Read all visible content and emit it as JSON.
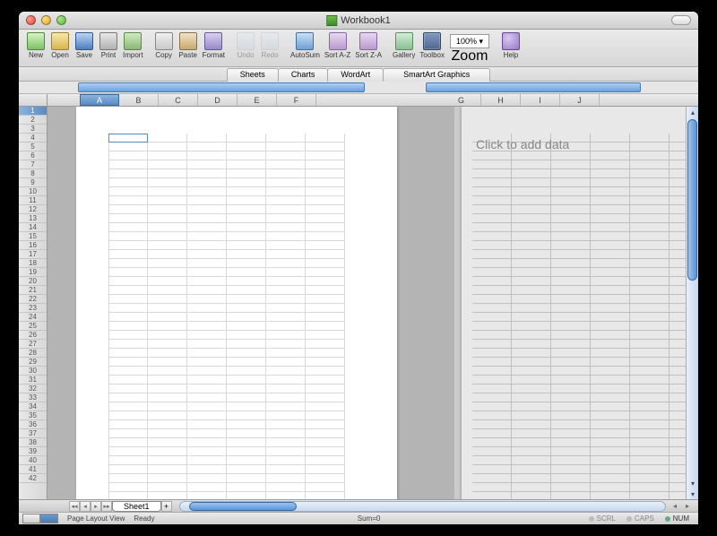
{
  "title": "Workbook1",
  "toolbar": [
    {
      "id": "new",
      "label": "New",
      "icon": "ic-new"
    },
    {
      "id": "open",
      "label": "Open",
      "icon": "ic-open"
    },
    {
      "id": "save",
      "label": "Save",
      "icon": "ic-save"
    },
    {
      "id": "print",
      "label": "Print",
      "icon": "ic-print"
    },
    {
      "id": "import",
      "label": "Import",
      "icon": "ic-import"
    },
    {
      "sep": true
    },
    {
      "id": "copy",
      "label": "Copy",
      "icon": "ic-copy"
    },
    {
      "id": "paste",
      "label": "Paste",
      "icon": "ic-paste"
    },
    {
      "id": "format",
      "label": "Format",
      "icon": "ic-format"
    },
    {
      "sep": true
    },
    {
      "id": "undo",
      "label": "Undo",
      "icon": "ic-undo",
      "disabled": true
    },
    {
      "id": "redo",
      "label": "Redo",
      "icon": "ic-redo",
      "disabled": true
    },
    {
      "sep": true
    },
    {
      "id": "autosum",
      "label": "AutoSum",
      "icon": "ic-autosum"
    },
    {
      "id": "sortaz",
      "label": "Sort A-Z",
      "icon": "ic-sortaz"
    },
    {
      "id": "sortza",
      "label": "Sort Z-A",
      "icon": "ic-sortza"
    },
    {
      "sep": true
    },
    {
      "id": "gallery",
      "label": "Gallery",
      "icon": "ic-gallery"
    },
    {
      "id": "toolbox",
      "label": "Toolbox",
      "icon": "ic-toolbox"
    },
    {
      "zoom": true,
      "value": "100%",
      "label": "Zoom"
    },
    {
      "sep": true
    },
    {
      "id": "help",
      "label": "Help",
      "icon": "ic-help"
    }
  ],
  "subtabs": [
    "Sheets",
    "Charts",
    "WordArt",
    "SmartArt Graphics"
  ],
  "columns_left": [
    "A",
    "B",
    "C",
    "D",
    "E",
    "F"
  ],
  "columns_right": [
    "G",
    "H",
    "I",
    "J"
  ],
  "row_count": 42,
  "selected_cell": "A1",
  "placeholder_right": "Click to add data",
  "sheet_tab": "Sheet1",
  "status": {
    "view": "Page Layout View",
    "ready": "Ready",
    "sum": "Sum=0",
    "indicators": [
      {
        "label": "SCRL",
        "on": false
      },
      {
        "label": "CAPS",
        "on": false
      },
      {
        "label": "NUM",
        "on": true
      }
    ]
  }
}
